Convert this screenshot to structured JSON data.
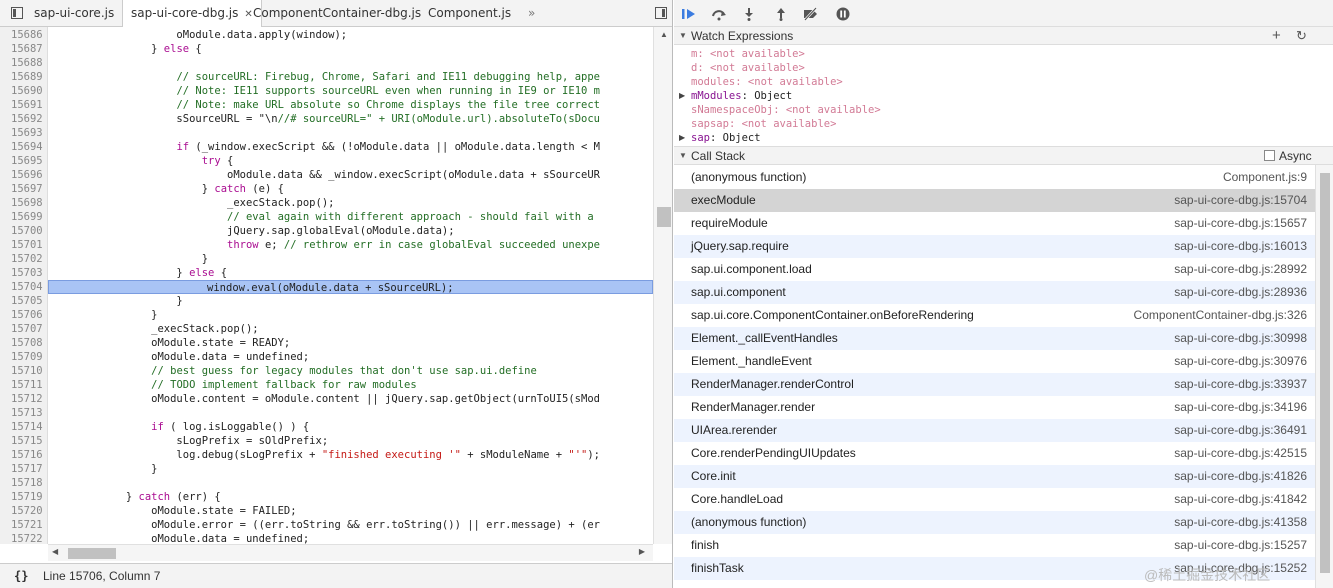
{
  "tabs": [
    {
      "label": "sap-ui-core.js",
      "active": false
    },
    {
      "label": "sap-ui-core-dbg.js",
      "active": true
    },
    {
      "label": "ComponentContainer-dbg.js",
      "active": false
    },
    {
      "label": "Component.js",
      "active": false
    }
  ],
  "tabs_overflow": "»",
  "code": {
    "lines": [
      {
        "n": "15686",
        "t": "                    oModule.data.apply(window);"
      },
      {
        "n": "15687",
        "t": "                } else {"
      },
      {
        "n": "15688",
        "t": ""
      },
      {
        "n": "15689",
        "t": "                    // sourceURL: Firebug, Chrome, Safari and IE11 debugging help, appe"
      },
      {
        "n": "15690",
        "t": "                    // Note: IE11 supports sourceURL even when running in IE9 or IE10 m"
      },
      {
        "n": "15691",
        "t": "                    // Note: make URL absolute so Chrome displays the file tree correct"
      },
      {
        "n": "15692",
        "t": "                    sSourceURL = \"\\n//# sourceURL=\" + URI(oModule.url).absoluteTo(sDocu"
      },
      {
        "n": "15693",
        "t": ""
      },
      {
        "n": "15694",
        "t": "                    if (_window.execScript && (!oModule.data || oModule.data.length < M"
      },
      {
        "n": "15695",
        "t": "                        try {"
      },
      {
        "n": "15696",
        "t": "                            oModule.data && _window.execScript(oModule.data + sSourceUR"
      },
      {
        "n": "15697",
        "t": "                        } catch (e) {"
      },
      {
        "n": "15698",
        "t": "                            _execStack.pop();"
      },
      {
        "n": "15699",
        "t": "                            // eval again with different approach - should fail with a"
      },
      {
        "n": "15700",
        "t": "                            jQuery.sap.globalEval(oModule.data);"
      },
      {
        "n": "15701",
        "t": "                            throw e; // rethrow err in case globalEval succeeded unexpe"
      },
      {
        "n": "15702",
        "t": "                        }"
      },
      {
        "n": "15703",
        "t": "                    } else {"
      },
      {
        "n": "15704",
        "t": "                        _window.eval(oModule.data + sSourceURL);"
      },
      {
        "n": "15705",
        "t": "                    }"
      },
      {
        "n": "15706",
        "t": "                }"
      },
      {
        "n": "15707",
        "t": "                _execStack.pop();"
      },
      {
        "n": "15708",
        "t": "                oModule.state = READY;"
      },
      {
        "n": "15709",
        "t": "                oModule.data = undefined;"
      },
      {
        "n": "15710",
        "t": "                // best guess for legacy modules that don't use sap.ui.define"
      },
      {
        "n": "15711",
        "t": "                // TODO implement fallback for raw modules"
      },
      {
        "n": "15712",
        "t": "                oModule.content = oModule.content || jQuery.sap.getObject(urnToUI5(sMod"
      },
      {
        "n": "15713",
        "t": ""
      },
      {
        "n": "15714",
        "t": "                if ( log.isLoggable() ) {"
      },
      {
        "n": "15715",
        "t": "                    sLogPrefix = sOldPrefix;"
      },
      {
        "n": "15716",
        "t": "                    log.debug(sLogPrefix + \"finished executing '\" + sModuleName + \"'\");"
      },
      {
        "n": "15717",
        "t": "                }"
      },
      {
        "n": "15718",
        "t": ""
      },
      {
        "n": "15719",
        "t": "            } catch (err) {"
      },
      {
        "n": "15720",
        "t": "                oModule.state = FAILED;"
      },
      {
        "n": "15721",
        "t": "                oModule.error = ((err.toString && err.toString()) || err.message) + (er"
      },
      {
        "n": "15722",
        "t": "                oModule.data = undefined;"
      },
      {
        "n": "15723",
        "t": ""
      },
      {
        "n": "15724",
        "t": ""
      }
    ],
    "highlighted_line": "15704"
  },
  "status": {
    "position": "Line 15706, Column 7",
    "braces_icon": "{}"
  },
  "watch": {
    "title": "Watch Expressions",
    "add_icon": "+",
    "refresh_icon": "↻",
    "items": [
      {
        "key": "m",
        "value": "<not available>",
        "expandable": false,
        "available": false
      },
      {
        "key": "d",
        "value": "<not available>",
        "expandable": false,
        "available": false
      },
      {
        "key": "modules",
        "value": "<not available>",
        "expandable": false,
        "available": false
      },
      {
        "key": "mModules",
        "value": "Object",
        "expandable": true,
        "available": true
      },
      {
        "key": "sNamespaceObj",
        "value": "<not available>",
        "expandable": false,
        "available": false
      },
      {
        "key": "sapsap",
        "value": "<not available>",
        "expandable": false,
        "available": false
      },
      {
        "key": "sap",
        "value": "Object",
        "expandable": true,
        "available": true
      }
    ]
  },
  "callstack": {
    "title": "Call Stack",
    "async_label": "Async",
    "frames": [
      {
        "fn": "(anonymous function)",
        "loc": "Component.js:9"
      },
      {
        "fn": "execModule",
        "loc": "sap-ui-core-dbg.js:15704"
      },
      {
        "fn": "requireModule",
        "loc": "sap-ui-core-dbg.js:15657"
      },
      {
        "fn": "jQuery.sap.require",
        "loc": "sap-ui-core-dbg.js:16013"
      },
      {
        "fn": "sap.ui.component.load",
        "loc": "sap-ui-core-dbg.js:28992"
      },
      {
        "fn": "sap.ui.component",
        "loc": "sap-ui-core-dbg.js:28936"
      },
      {
        "fn": "sap.ui.core.ComponentContainer.onBeforeRendering",
        "loc": "ComponentContainer-dbg.js:326"
      },
      {
        "fn": "Element._callEventHandles",
        "loc": "sap-ui-core-dbg.js:30998"
      },
      {
        "fn": "Element._handleEvent",
        "loc": "sap-ui-core-dbg.js:30976"
      },
      {
        "fn": "RenderManager.renderControl",
        "loc": "sap-ui-core-dbg.js:33937"
      },
      {
        "fn": "RenderManager.render",
        "loc": "sap-ui-core-dbg.js:34196"
      },
      {
        "fn": "UIArea.rerender",
        "loc": "sap-ui-core-dbg.js:36491"
      },
      {
        "fn": "Core.renderPendingUIUpdates",
        "loc": "sap-ui-core-dbg.js:42515"
      },
      {
        "fn": "Core.init",
        "loc": "sap-ui-core-dbg.js:41826"
      },
      {
        "fn": "Core.handleLoad",
        "loc": "sap-ui-core-dbg.js:41842"
      },
      {
        "fn": "(anonymous function)",
        "loc": "sap-ui-core-dbg.js:41358"
      },
      {
        "fn": "finish",
        "loc": "sap-ui-core-dbg.js:15257"
      },
      {
        "fn": "finishTask",
        "loc": "sap-ui-core-dbg.js:15252"
      }
    ],
    "selected_index": 1
  },
  "watermark": "@稀土掘金技术社区"
}
